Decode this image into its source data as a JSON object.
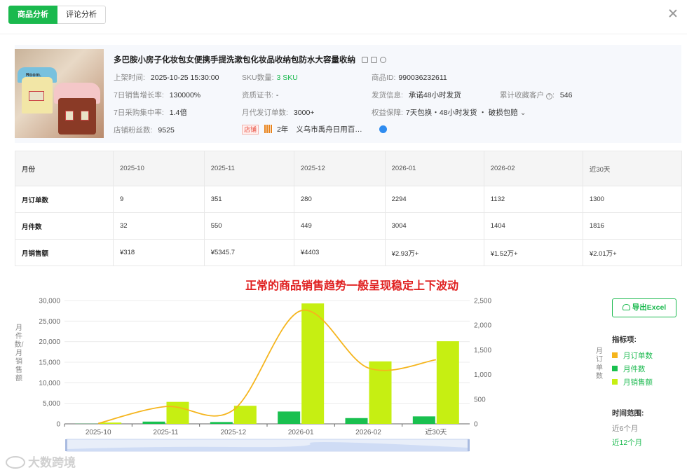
{
  "tabs": [
    {
      "label": "商品分析",
      "active": true
    },
    {
      "label": "评论分析",
      "active": false
    }
  ],
  "product": {
    "title": "多巴胺小房子化妆包女便携手提洗漱包化妆品收纳包防水大容量收纳",
    "image_text": "Room.",
    "listed_label": "上架时间:",
    "listed_value": "2025-10-25 15:30:00",
    "sku_label": "SKU数量:",
    "sku_value": "3 SKU",
    "id_label": "商品ID:",
    "id_value": "990036232611",
    "growth_label": "7日销售增长率:",
    "growth_value": "130000%",
    "cert_label": "资质证书:",
    "cert_value": "-",
    "ship_label": "发货信息:",
    "ship_value": "承诺48小时发货",
    "fav_label": "累计收藏客户",
    "fav_value": "546",
    "concentration_label": "7日采购集中率:",
    "concentration_value": "1.4倍",
    "dropship_label": "月代发订单数:",
    "dropship_value": "3000+",
    "rights_label": "权益保障:",
    "rights_value": "7天包换・48小时发货 ・ 破损包赔",
    "fans_label": "店铺粉丝数:",
    "fans_value": "9525",
    "store_tag": "店铺",
    "store_years": "2年",
    "store_name": "义乌市禹舟日用百…"
  },
  "table": {
    "header": [
      "月份",
      "2025-10",
      "2025-11",
      "2025-12",
      "2026-01",
      "2026-02",
      "近30天"
    ],
    "rows": [
      [
        "月订单数",
        "9",
        "351",
        "280",
        "2294",
        "1132",
        "1300"
      ],
      [
        "月件数",
        "32",
        "550",
        "449",
        "3004",
        "1404",
        "1816"
      ],
      [
        "月销售额",
        "¥318",
        "¥5345.7",
        "¥4403",
        "¥2.93万+",
        "¥1.52万+",
        "¥2.01万+"
      ]
    ]
  },
  "chart_title": "正常的商品销售趋势一般呈现稳定上下波动",
  "chart_data": {
    "type": "bar",
    "categories": [
      "2025-10",
      "2025-11",
      "2025-12",
      "2026-01",
      "2026-02",
      "近30天"
    ],
    "series": [
      {
        "name": "月订单数",
        "kind": "line",
        "axis": "right",
        "color": "#f5b51d",
        "values": [
          9,
          351,
          280,
          2294,
          1132,
          1300
        ]
      },
      {
        "name": "月件数",
        "kind": "bar",
        "axis": "left",
        "color": "#19c04f",
        "values": [
          32,
          550,
          449,
          3004,
          1404,
          1816
        ]
      },
      {
        "name": "月销售额",
        "kind": "bar",
        "axis": "left",
        "color": "#c6ef12",
        "values": [
          318,
          5345.7,
          4403,
          29300,
          15200,
          20100
        ]
      }
    ],
    "ylim_left": [
      0,
      30000
    ],
    "ylim_right": [
      0,
      2500
    ],
    "yticks_left": [
      "0",
      "5,000",
      "10,000",
      "15,000",
      "20,000",
      "25,000",
      "30,000"
    ],
    "yticks_right": [
      "0",
      "500",
      "1,000",
      "1,500",
      "2,000",
      "2,500"
    ],
    "ylabel_left": "月件数/月销售额",
    "ylabel_right": "月订单数"
  },
  "panel": {
    "export_label": "导出Excel",
    "metrics_head": "指标项:",
    "range_head": "时间范围:",
    "ranges": [
      "近6个月",
      "近12个月"
    ],
    "selected_range": "近12个月"
  },
  "watermark": "大数跨境"
}
